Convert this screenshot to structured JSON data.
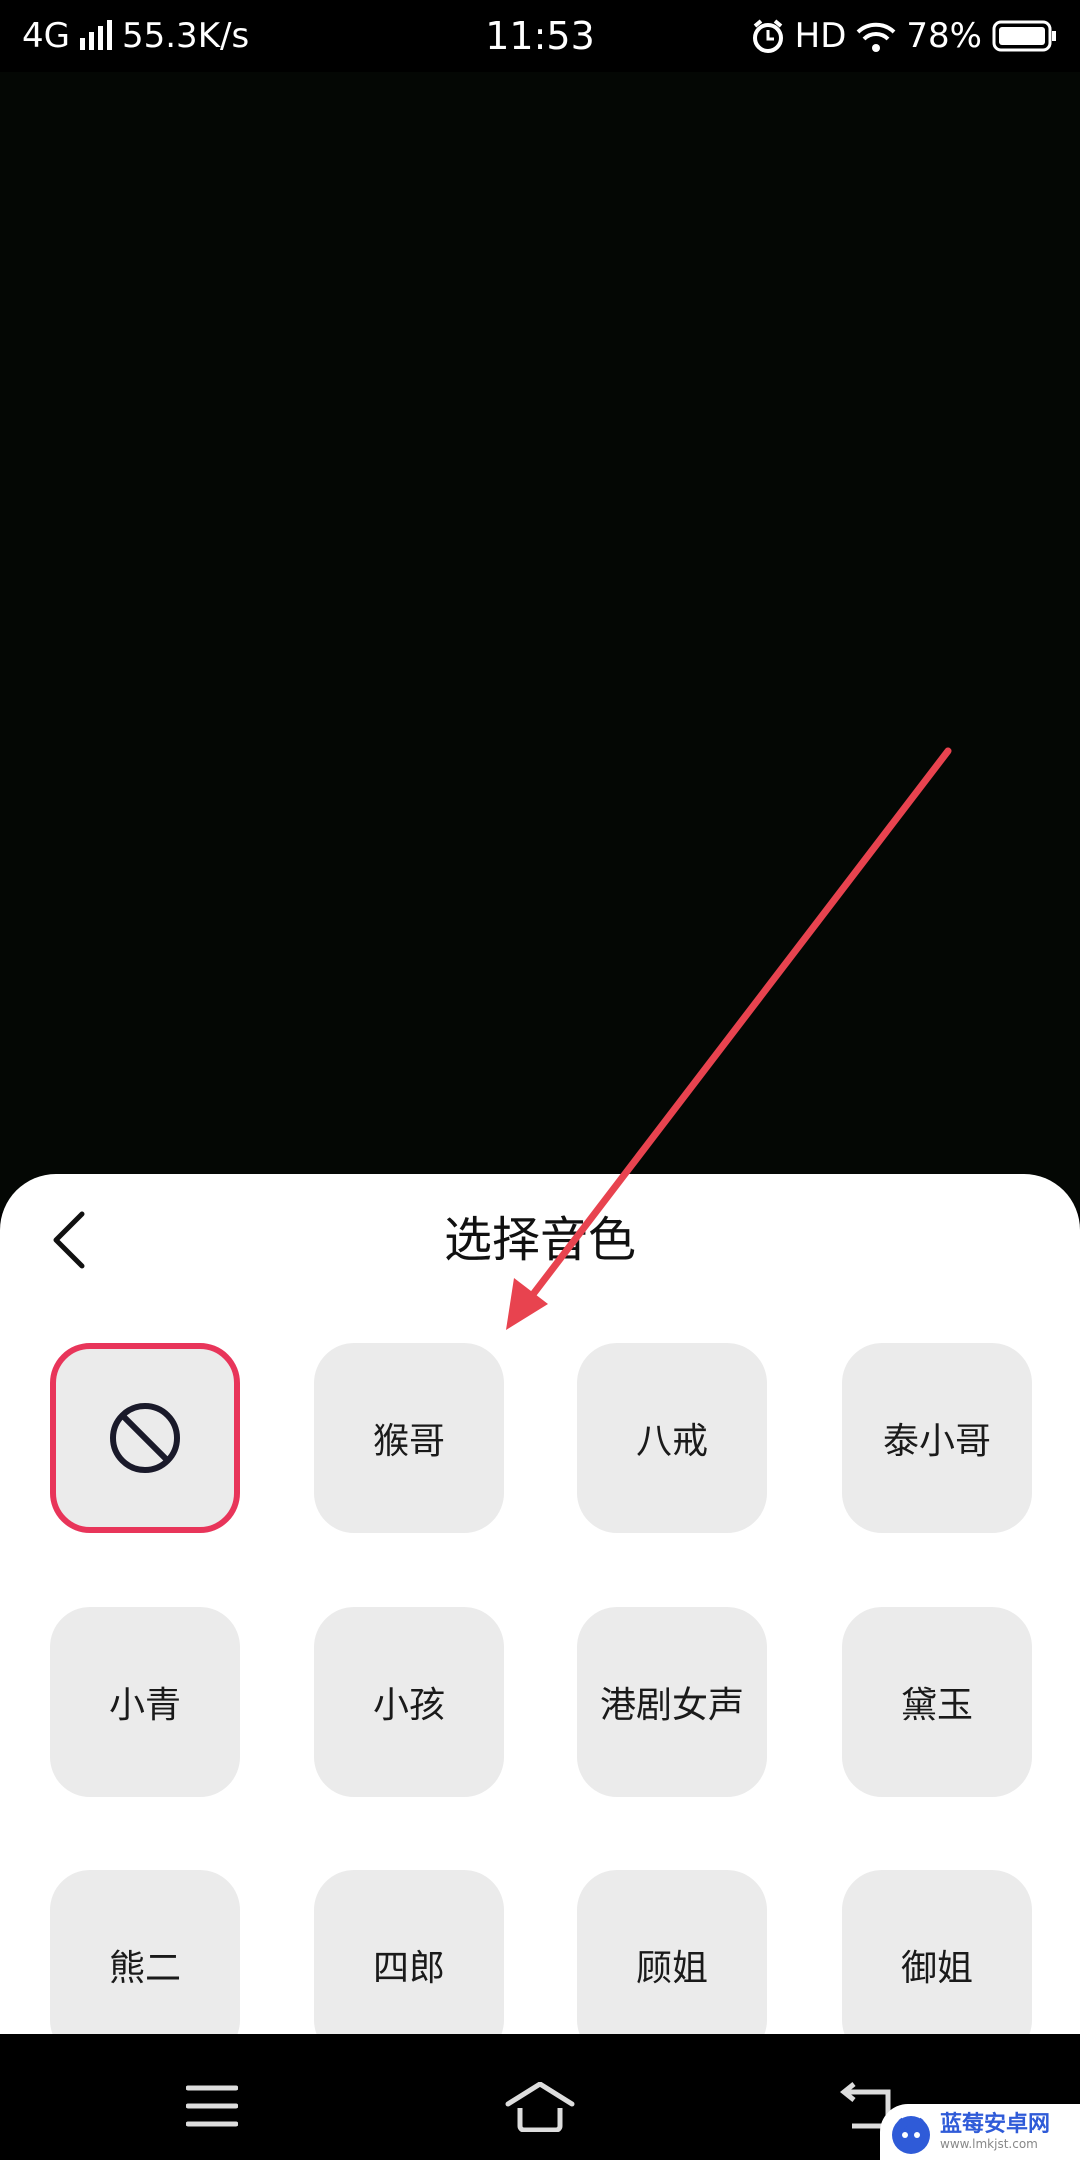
{
  "status_bar": {
    "network": "4G",
    "speed": "55.3K/s",
    "time": "11:53",
    "hd": "HD",
    "battery": "78%",
    "icons": [
      "signal-icon",
      "alarm-icon",
      "wifi-icon",
      "battery-icon"
    ]
  },
  "sheet": {
    "title": "选择音色",
    "back_icon": "chevron-left-icon",
    "none_icon": "prohibited-icon",
    "voices": [
      "猴哥",
      "八戒",
      "泰小哥",
      "小青",
      "小孩",
      "港剧女声",
      "黛玉",
      "熊二",
      "四郎",
      "顾姐",
      "御姐"
    ],
    "selected": "none"
  },
  "nav": {
    "buttons": [
      "menu-icon",
      "home-icon",
      "back-icon"
    ]
  },
  "watermark": {
    "name": "蓝莓安卓网",
    "url": "www.lmkjst.com"
  },
  "colors": {
    "selected_border": "#e8355a",
    "tile_bg": "#ebebeb",
    "annotation_arrow": "#e8434f"
  }
}
